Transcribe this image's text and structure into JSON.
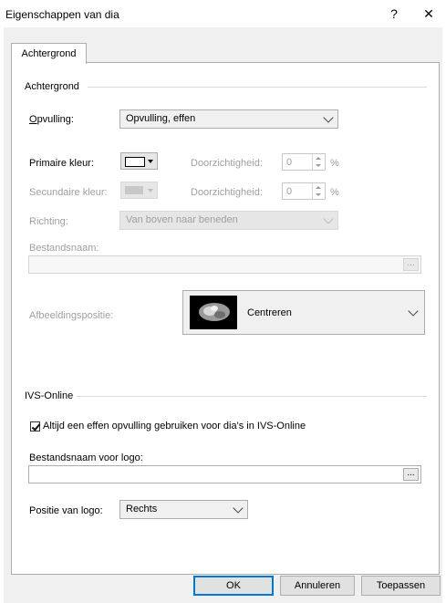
{
  "window": {
    "title": "Eigenschappen van dia",
    "help_glyph": "?",
    "close_glyph": "✕"
  },
  "tab": {
    "label": "Achtergrond"
  },
  "background_group": {
    "heading": "Achtergrond",
    "fill_label": "Opvulling:",
    "fill_value": "Opvulling, effen",
    "primary_color_label": "Primaire kleur:",
    "transparency_label_1": "Doorzichtigheid:",
    "transparency_value_1": "0",
    "secondary_color_label": "Secundaire kleur:",
    "transparency_label_2": "Doorzichtigheid:",
    "transparency_value_2": "0",
    "percent_symbol": "%",
    "direction_label": "Richting:",
    "direction_value": "Van boven naar beneden",
    "filename_label": "Bestandsnaam:",
    "filename_value": "",
    "browse_label": "...",
    "image_position_label": "Afbeeldingspositie:",
    "image_position_value": "Centreren"
  },
  "ivs_group": {
    "heading": "IVS-Online",
    "checkbox_label": "Altijd een effen opvulling gebruiken voor dia's in IVS-Online",
    "checkbox_checked": true,
    "logo_filename_label": "Bestandsnaam voor logo:",
    "logo_filename_value": "",
    "browse_label": "...",
    "logo_position_label": "Positie van logo:",
    "logo_position_value": "Rechts"
  },
  "buttons": {
    "ok": "OK",
    "cancel": "Annuleren",
    "apply": "Toepassen"
  },
  "colors": {
    "primary_swatch": "#ffffff",
    "secondary_swatch": "#c8c8c8",
    "focus_blue": "#0078d7"
  }
}
